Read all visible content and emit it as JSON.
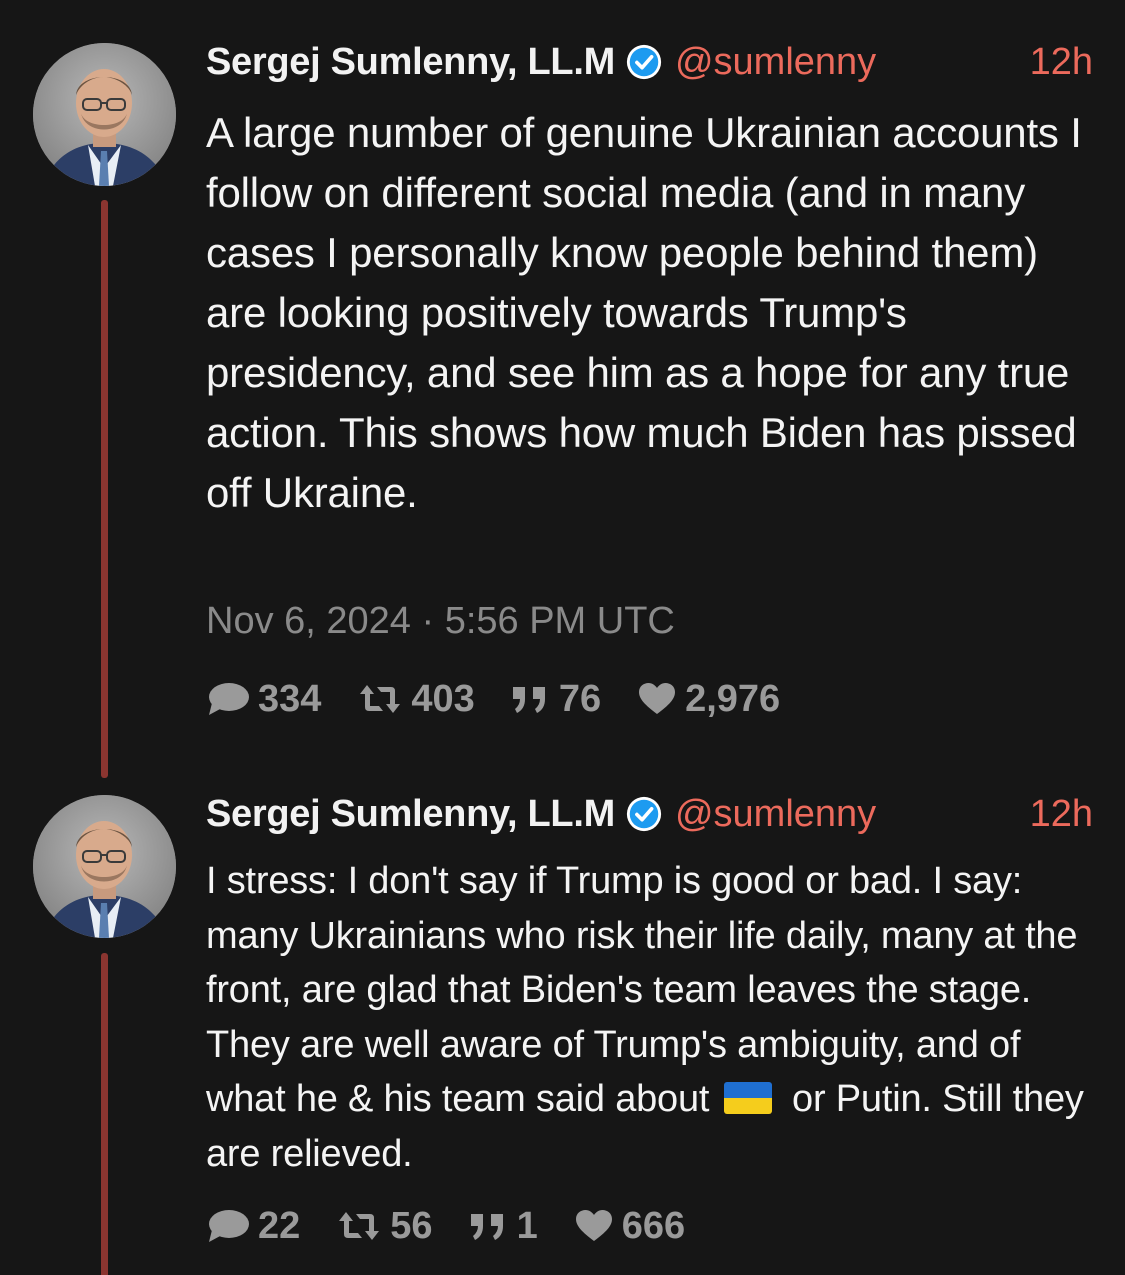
{
  "colors": {
    "background": "#161616",
    "accent": "#ec6a5c",
    "thread_line": "#8b3530",
    "verified_badge": "#1d9bf0",
    "muted": "#8a8a8a"
  },
  "tweets": [
    {
      "author": {
        "display_name": "Sergej Sumlenny, LL.M",
        "handle": "@sumlenny",
        "verified": true
      },
      "time": "12h",
      "text": "A large number of genuine Ukrainian accounts I follow on different social media (and in many cases I personally know people behind them) are looking positively towards Trump's presidency, and see him as a hope for any true action. This shows how much Biden has pissed off Ukraine.",
      "date": "Nov 6, 2024 · 5:56 PM UTC",
      "stats": {
        "replies": "334",
        "retweets": "403",
        "quotes": "76",
        "likes": "2,976"
      }
    },
    {
      "author": {
        "display_name": "Sergej Sumlenny, LL.M",
        "handle": "@sumlenny",
        "verified": true
      },
      "time": "12h",
      "text_before_flag": "I stress: I don't say if Trump is good or bad. I say: many Ukrainians who risk their life daily, many at the front, are glad that Biden's team leaves the stage. They are well aware of Trump's ambiguity, and of what he & his team said about",
      "flag_icon": "ukraine-flag-emoji",
      "text_after_flag": "or Putin. Still they are relieved.",
      "stats": {
        "replies": "22",
        "retweets": "56",
        "quotes": "1",
        "likes": "666"
      }
    }
  ],
  "icons": {
    "reply": "comment-bubble-icon",
    "retweet": "retweet-icon",
    "quote": "quote-icon",
    "like": "heart-icon",
    "verified": "verified-check-icon"
  }
}
